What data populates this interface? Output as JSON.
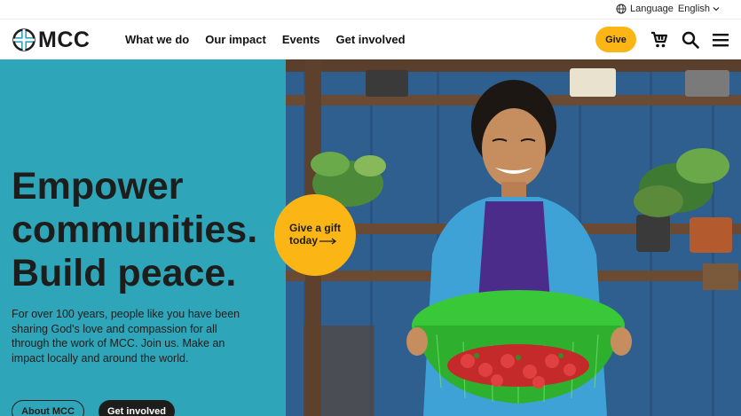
{
  "utility": {
    "language_label": "Language",
    "language_value": "English",
    "globe_icon": "globe-icon",
    "chevron_icon": "chevron-down-icon"
  },
  "header": {
    "logo_text": "MCC",
    "nav": [
      "What we do",
      "Our impact",
      "Events",
      "Get involved"
    ],
    "give_label": "Give",
    "icons": [
      "cart-icon",
      "search-icon",
      "menu-icon"
    ]
  },
  "hero": {
    "title_lines": [
      "Empower",
      "communities.",
      "Build peace."
    ],
    "body": "For over 100 years, people like you have been sharing God's love and compassion for all through the work of MCC. Join us. Make an impact locally and around the world.",
    "about_label": "About MCC",
    "get_involved_label": "Get involved",
    "gift_line1": "Give a gift",
    "gift_line2": "today"
  },
  "colors": {
    "teal": "#2fa5b9",
    "yellow": "#fbb616",
    "dark": "#1d1d1b"
  }
}
